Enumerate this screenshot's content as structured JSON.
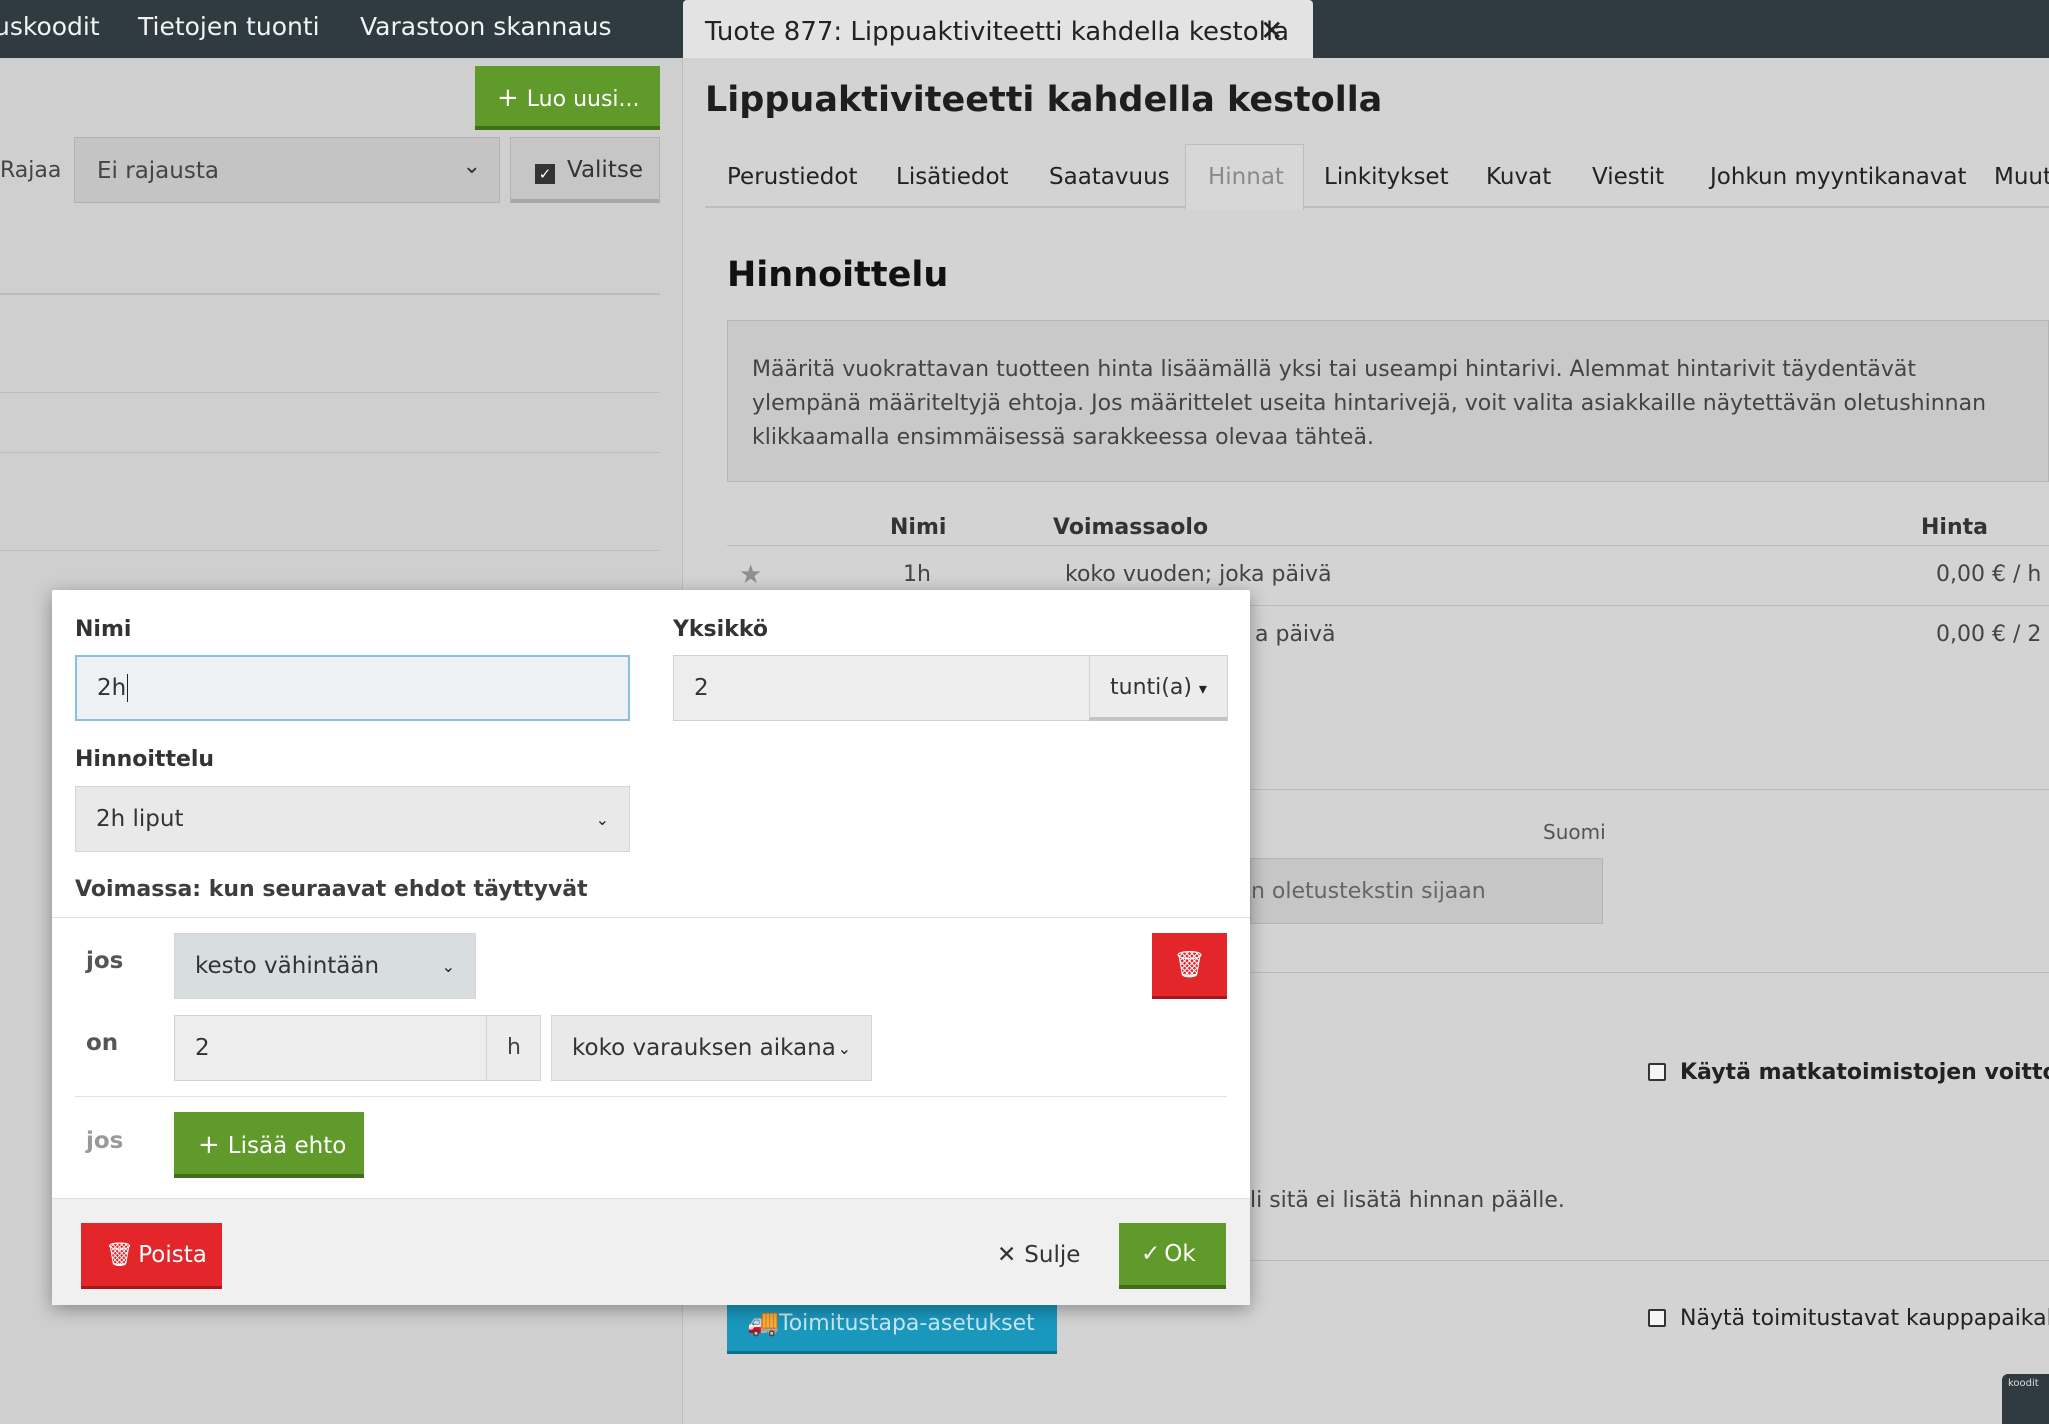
{
  "top_nav": {
    "items": [
      "uskoodit",
      "Tietojen tuonti",
      "Varastoon skannaus"
    ]
  },
  "open_tab": {
    "title": "Tuote 877: Lippuaktiviteetti kahdella kestolla",
    "close_glyph": "✕"
  },
  "left_panel": {
    "create_button": "Luo uusi...",
    "filter_label": "Rajaa",
    "filter_value": "Ei rajausta",
    "select_button": "Valitse"
  },
  "product": {
    "heading": "Lippuaktiviteetti kahdella kestolla",
    "tabs": [
      "Perustiedot",
      "Lisätiedot",
      "Saatavuus",
      "Hinnat",
      "Linkitykset",
      "Kuvat",
      "Viestit",
      "Johkun myyntikanavat",
      "Muut"
    ],
    "active_tab": "Hinnat",
    "section_title": "Hinnoittelu",
    "info_text": "Määritä vuokrattavan tuotteen hinta lisäämällä yksi tai useampi hintarivi. Alemmat hintarivit täydentävät ylempänä määriteltyjä ehtoja. Jos määrittelet useita hintarivejä, voit valita asiakkaille näytettävän oletushinnan klikkaamalla ensimmäisessä sarakkeessa olevaa tähteä.",
    "table": {
      "headers": {
        "name": "Nimi",
        "validity": "Voimassaolo",
        "price": "Hinta"
      },
      "rows": [
        {
          "name": "1h",
          "validity": "koko vuoden; joka päivä",
          "price": "0,00 € / h"
        },
        {
          "name": "",
          "validity": "a päivä",
          "price": "0,00 € / 2"
        }
      ]
    },
    "language_label": "Suomi",
    "text_placeholder_fragment": "n oletustekstin sijaan",
    "travel_agency_checkbox": "Käytä matkatoimistojen voittom",
    "price_note_fragment": "li sitä ei lisätä hinnan päälle.",
    "shipping_button": "Toimitustapa-asetukset",
    "show_shipping_checkbox": "Näytä toimitustavat kauppapaikall",
    "corner_badge": "koodit"
  },
  "modal": {
    "name_label": "Nimi",
    "name_value": "2h",
    "unit_label": "Yksikkö",
    "unit_value": "2",
    "unit_type": "tunti(a)",
    "pricing_label": "Hinnoittelu",
    "pricing_value": "2h liput",
    "validity_heading": "Voimassa: kun seuraavat ehdot täyttyvät",
    "condition": {
      "if_label": "jos",
      "field": "kesto vähintään",
      "on_label": "on",
      "amount": "2",
      "amount_unit": "h",
      "scope": "koko varauksen aikana"
    },
    "add_if_label": "jos",
    "add_condition_button": "Lisää ehto",
    "delete_button": "Poista",
    "close_button": "Sulje",
    "ok_button": "Ok"
  },
  "colors": {
    "accent_green": "#5f9a2a",
    "danger_red": "#e2262a",
    "teal": "#1a97bd",
    "topbar": "#2f3a41"
  }
}
